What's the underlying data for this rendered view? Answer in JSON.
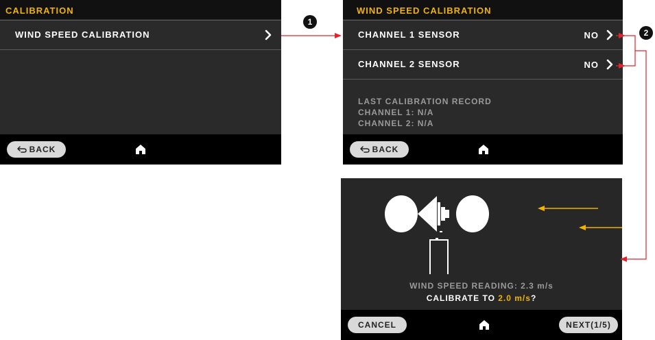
{
  "screen1": {
    "title": "CALIBRATION",
    "row_label": "WIND SPEED CALIBRATION",
    "back_label": "BACK"
  },
  "screen2": {
    "title": "WIND SPEED CALIBRATION",
    "rows": [
      {
        "label": "CHANNEL 1 SENSOR",
        "value": "NO"
      },
      {
        "label": "CHANNEL 2 SENSOR",
        "value": "NO"
      }
    ],
    "record_title": "LAST CALIBRATION RECORD",
    "record_ch1": "CHANNEL 1: N/A",
    "record_ch2": "CHANNEL 2: N/A",
    "back_label": "BACK"
  },
  "screen3": {
    "reading": "WIND SPEED READING: 2.3 m/s",
    "calibrate_prefix": "CALIBRATE TO ",
    "calibrate_value": "2.0 m/s",
    "calibrate_suffix": "?",
    "cancel_label": "CANCEL",
    "next_label": "NEXT(1/5)"
  },
  "annotations": {
    "step1": "1",
    "step2": "2"
  },
  "colors": {
    "accent": "#f0b400",
    "arrow": "#e0242c"
  },
  "icons": [
    "chevron-right-icon",
    "home-icon",
    "back-arrow-icon",
    "anemometer-icon",
    "wind-arrow-icon"
  ]
}
